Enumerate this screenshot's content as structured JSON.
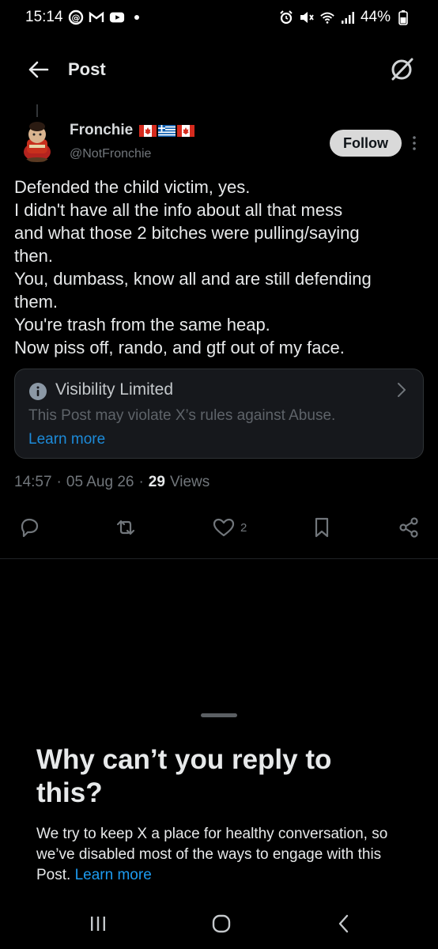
{
  "status_bar": {
    "time": "15:14",
    "battery": "44%",
    "left_icons": [
      "threads-icon",
      "gmail-icon",
      "youtube-icon"
    ],
    "right_icons": [
      "alarm-icon",
      "mute-icon",
      "wifi-icon",
      "signal-icon",
      "battery-icon"
    ]
  },
  "header": {
    "title": "Post",
    "back_icon": "arrow-left-icon",
    "grok_icon": "grok-icon"
  },
  "post": {
    "author": {
      "name": "Fronchie",
      "handle": "@NotFronchie",
      "flags": [
        "canada",
        "greece",
        "canada"
      ]
    },
    "follow_label": "Follow",
    "lines": [
      "Defended the child victim, yes.",
      "I didn't have all the info about all that mess",
      "and what those 2 bitches were pulling/saying",
      "then.",
      "You, dumbass, know all and are still defending",
      "them.",
      "You're trash from the same heap.",
      "Now piss off, rando, and gtf out of my face."
    ],
    "visibility": {
      "title": "Visibility Limited",
      "description": "This Post may violate X’s rules against Abuse.",
      "link": "Learn more"
    },
    "meta": {
      "time": "14:57",
      "sep1": "·",
      "date": "05 Aug 26",
      "sep2": "·",
      "views_count": "29",
      "views_label": "Views"
    },
    "actions": {
      "likes": "2"
    }
  },
  "sheet": {
    "title": "Why can’t you reply to this?",
    "body": "We try to keep X a place for healthy conversation, so we’ve disabled most of the ways to engage with this Post.",
    "link": "Learn more"
  },
  "colors": {
    "background": "#000000",
    "text": "#e7e9ea",
    "muted": "#71767b",
    "link": "#1d9bf0",
    "follow_bg": "#d9d9d9"
  }
}
